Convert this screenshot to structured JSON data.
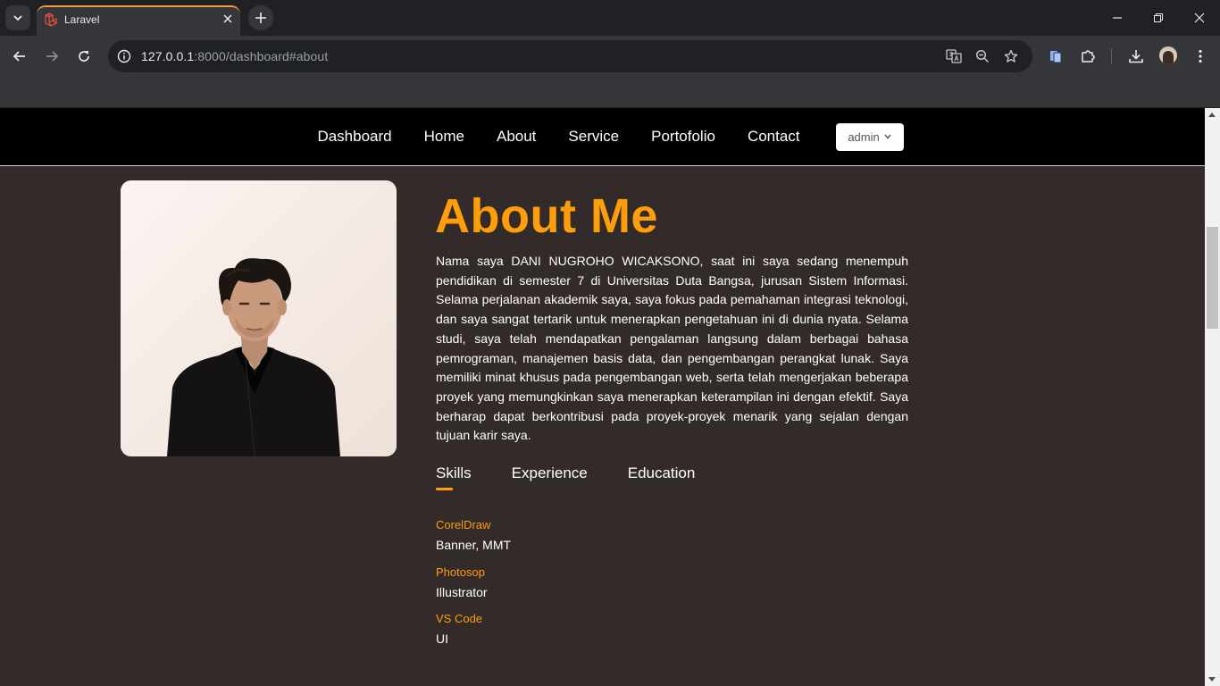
{
  "browser": {
    "tab_title": "Laravel",
    "url_host": "127.0.0.1",
    "url_rest": ":8000/dashboard#about"
  },
  "nav": {
    "links": [
      "Dashboard",
      "Home",
      "About",
      "Service",
      "Portofolio",
      "Contact"
    ],
    "user_label": "admin"
  },
  "about": {
    "title": "About Me",
    "paragraph": "Nama saya DANI NUGROHO WICAKSONO, saat ini saya sedang menempuh pendidikan di semester 7 di Universitas Duta Bangsa, jurusan Sistem Informasi. Selama perjalanan akademik saya, saya fokus pada pemahaman integrasi teknologi, dan saya sangat tertarik untuk menerapkan pengetahuan ini di dunia nyata. Selama studi, saya telah mendapatkan pengalaman langsung dalam berbagai bahasa pemrograman, manajemen basis data, dan pengembangan perangkat lunak. Saya memiliki minat khusus pada pengembangan web, serta telah mengerjakan beberapa proyek yang memungkinkan saya menerapkan keterampilan ini dengan efektif. Saya berharap dapat berkontribusi pada proyek-proyek menarik yang sejalan dengan tujuan karir saya.",
    "tabs": [
      "Skills",
      "Experience",
      "Education"
    ],
    "active_tab": "Skills",
    "skills": [
      {
        "name": "CorelDraw",
        "desc": "Banner, MMT"
      },
      {
        "name": "Photosop",
        "desc": "Illustrator"
      },
      {
        "name": "VS Code",
        "desc": "UI"
      }
    ]
  },
  "colors": {
    "accent": "#ff9e0b",
    "page_bg": "#332a2a",
    "navbar_bg": "#000000"
  },
  "icons": [
    "tab-search-icon",
    "laravel-icon",
    "close-icon",
    "plus-icon",
    "minimize-icon",
    "restore-icon",
    "back-icon",
    "forward-icon",
    "reload-icon",
    "site-info-icon",
    "translate-icon",
    "zoom-icon",
    "star-icon",
    "reading-mode-icon",
    "extensions-icon",
    "download-icon",
    "menu-icon",
    "chevron-down-icon"
  ]
}
